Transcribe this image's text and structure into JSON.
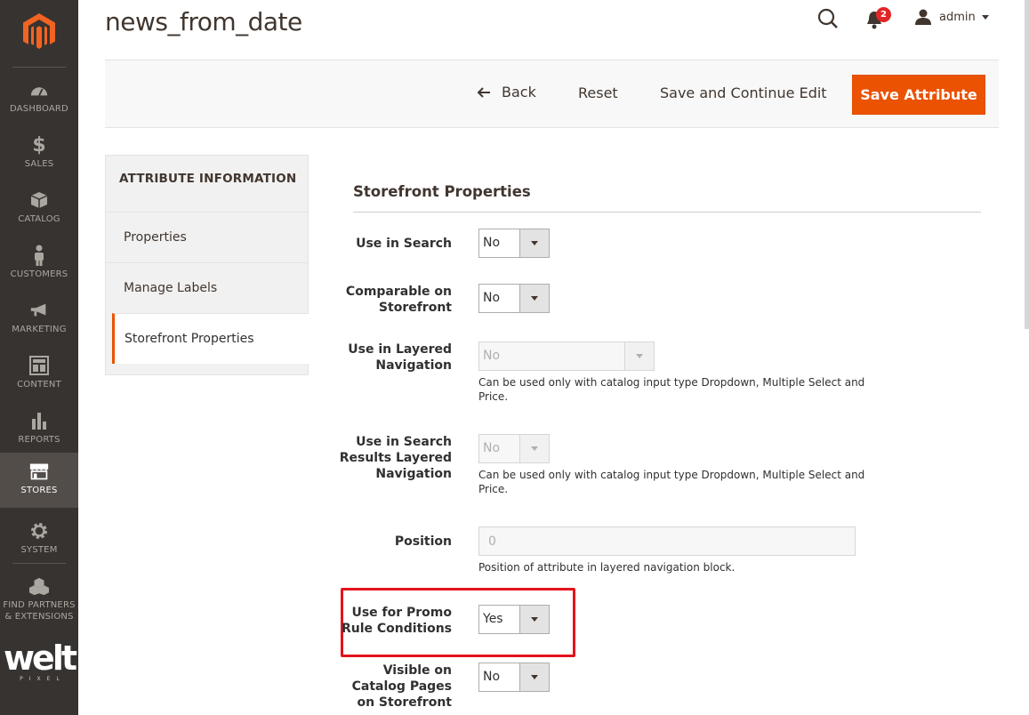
{
  "page": {
    "title": "news_from_date"
  },
  "header": {
    "notifications_count": "2",
    "user_name": "admin"
  },
  "sidebar": {
    "items": [
      {
        "label": "DASHBOARD",
        "icon": "dashboard-icon"
      },
      {
        "label": "SALES",
        "icon": "dollar-icon"
      },
      {
        "label": "CATALOG",
        "icon": "box-icon"
      },
      {
        "label": "CUSTOMERS",
        "icon": "person-icon"
      },
      {
        "label": "MARKETING",
        "icon": "megaphone-icon"
      },
      {
        "label": "CONTENT",
        "icon": "layout-icon"
      },
      {
        "label": "REPORTS",
        "icon": "bar-chart-icon"
      },
      {
        "label": "STORES",
        "icon": "storefront-icon",
        "active": true
      },
      {
        "label": "SYSTEM",
        "icon": "gear-icon"
      },
      {
        "label": "FIND PARTNERS & EXTENSIONS",
        "icon": "cubes-icon"
      }
    ],
    "brand_word": "welt",
    "brand_sub": "PIXEL"
  },
  "actions": {
    "back": "Back",
    "reset": "Reset",
    "save_continue": "Save and Continue Edit",
    "save": "Save Attribute"
  },
  "tabs": {
    "title": "ATTRIBUTE INFORMATION",
    "items": [
      {
        "label": "Properties"
      },
      {
        "label": "Manage Labels"
      },
      {
        "label": "Storefront Properties",
        "active": true
      }
    ]
  },
  "section": {
    "title": "Storefront Properties",
    "fields": {
      "use_in_search": {
        "label": "Use in Search",
        "value": "No"
      },
      "comparable": {
        "label_1": "Comparable on",
        "label_2": "Storefront",
        "value": "No"
      },
      "layered_nav": {
        "label_1": "Use in Layered",
        "label_2": "Navigation",
        "value": "No",
        "note_1": "Can be used only with catalog input type Dropdown, Multiple Select and",
        "note_2": "Price."
      },
      "search_layered_nav": {
        "label_1": "Use in Search",
        "label_2": "Results Layered",
        "label_3": "Navigation",
        "value": "No",
        "note_1": "Can be used only with catalog input type Dropdown, Multiple Select and",
        "note_2": "Price."
      },
      "position": {
        "label": "Position",
        "value": "0",
        "note": "Position of attribute in layered navigation block."
      },
      "promo_rules": {
        "label_1": "Use for Promo",
        "label_2": "Rule Conditions",
        "value": "Yes"
      },
      "visible_catalog": {
        "label_1": "Visible on",
        "label_2": "Catalog Pages",
        "label_3": "on Storefront",
        "value": "No"
      }
    }
  },
  "colors": {
    "accent": "#eb5202",
    "sidebar": "#373330",
    "highlight": "#e3131d"
  }
}
